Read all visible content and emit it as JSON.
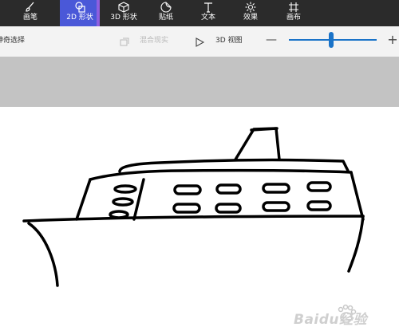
{
  "toolbar": {
    "tools": [
      {
        "label": "画笔",
        "icon": "brush-icon",
        "active": false
      },
      {
        "label": "2D 形状",
        "icon": "2d-shapes-icon",
        "active": true
      },
      {
        "label": "3D 形状",
        "icon": "3d-shapes-icon",
        "active": false
      },
      {
        "label": "贴纸",
        "icon": "stickers-icon",
        "active": false
      },
      {
        "label": "文本",
        "icon": "text-icon",
        "active": false
      },
      {
        "label": "效果",
        "icon": "effects-icon",
        "active": false
      },
      {
        "label": "画布",
        "icon": "canvas-icon",
        "active": false
      }
    ]
  },
  "subbar": {
    "magic_select": "神奇选择",
    "mixed_reality": "混合现实",
    "view_3d": "3D 视图",
    "zoom_minus": "—",
    "zoom_plus": "+",
    "zoom_level": 0.48
  },
  "watermark": {
    "text": "Baidu经验"
  },
  "colors": {
    "topbar": "#2b2b2b",
    "active_tab": "#4a58d8",
    "accent": "#1a73c8",
    "workspace": "#c3c3c3",
    "canvas": "#ffffff",
    "ink": "#000000"
  }
}
